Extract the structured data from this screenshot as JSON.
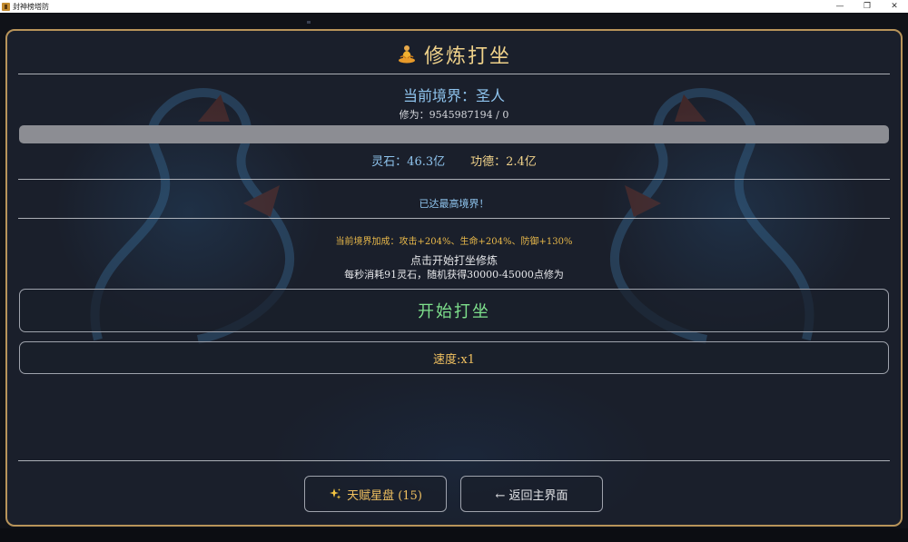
{
  "window": {
    "title": "封神榜塔防",
    "controls": [
      "—",
      "❐",
      "✕"
    ]
  },
  "panel": {
    "title": "修炼打坐",
    "realm_label": "当前境界：圣人",
    "cultivation": "修为：9545987194 / 0",
    "progress_fraction": 0,
    "spirit_stone": "灵石：46.3亿",
    "merit": "功德：2.4亿",
    "max_realm": "已达最高境界！",
    "bonus": "当前境界加成：攻击+204%、生命+204%、防御+130%",
    "hint_line1": "点击开始打坐修炼",
    "hint_line2": "每秒消耗91灵石，随机获得30000-45000点修为",
    "start_button": "开始打坐",
    "speed_button": "速度:x1",
    "talent_button": "天赋星盘 (15)",
    "back_button": "← 返回主界面"
  },
  "colors": {
    "accent_gold": "#f0d28a",
    "accent_blue": "#8fc4ee",
    "start_green": "#7ee08c",
    "panel_border": "#b8945a"
  },
  "icons": {
    "title_icon": "person-meditating-icon",
    "talent_icon": "sparkles-icon"
  }
}
